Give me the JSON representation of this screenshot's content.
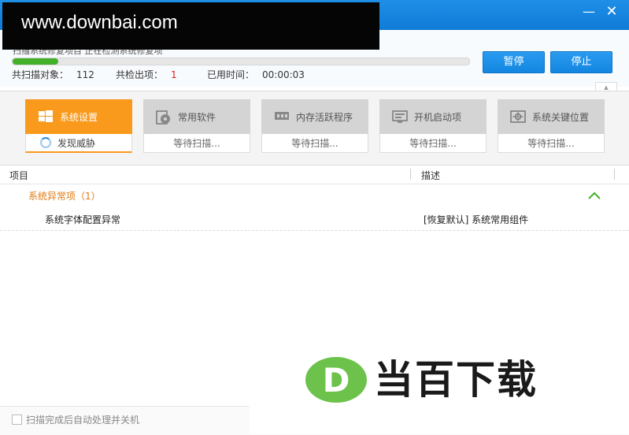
{
  "watermark_top": "www.downbai.com",
  "window": {
    "minimize_symbol": "—",
    "close_symbol": "✕"
  },
  "scan": {
    "status_text": "扫描系统修复项目 正在检测系统修复项",
    "progress_percent": 10,
    "objects_label": "共扫描对象：",
    "objects_value": "112",
    "found_label": "共检出项：",
    "found_value": "1",
    "time_label": "已用时间：",
    "time_value": "00:00:03"
  },
  "buttons": {
    "pause": "暂停",
    "stop": "停止"
  },
  "categories": [
    {
      "label": "系统设置",
      "status": "发现威胁"
    },
    {
      "label": "常用软件",
      "status": "等待扫描..."
    },
    {
      "label": "内存活跃程序",
      "status": "等待扫描..."
    },
    {
      "label": "开机启动项",
      "status": "等待扫描..."
    },
    {
      "label": "系统关键位置",
      "status": "等待扫描..."
    }
  ],
  "table": {
    "col_item": "项目",
    "col_desc": "描述",
    "group_label": "系统异常项（1）",
    "rows": [
      {
        "name": "系统字体配置异常",
        "desc": "[恢复默认] 系统常用组件"
      }
    ]
  },
  "footer": {
    "auto_label": "扫描完成后自动处理并关机"
  },
  "watermark_br": {
    "logo_letter": "D",
    "text": "当百下载"
  },
  "colors": {
    "accent": "#f99a1c",
    "primary": "#1286e0",
    "progress": "#43b02a",
    "logo_green": "#6cc24a"
  }
}
